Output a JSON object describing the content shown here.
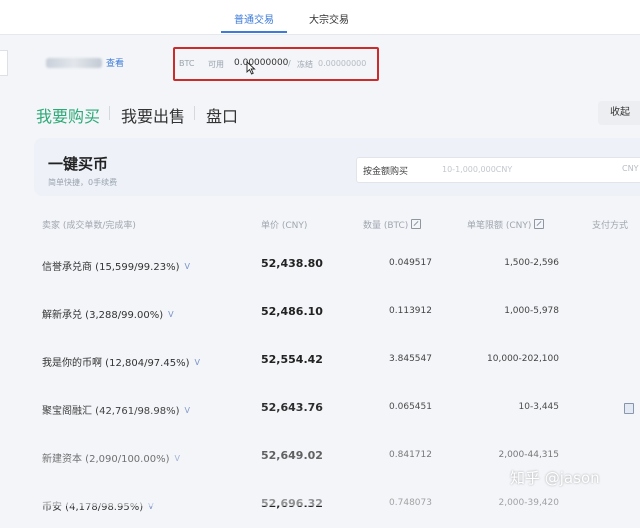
{
  "top_tabs": {
    "normal": "普通交易",
    "block": "大宗交易"
  },
  "account": {
    "view_link": "查看",
    "balance_currency": "BTC",
    "available_label": "可用",
    "available_value": "0.00000000",
    "separator": "/",
    "frozen_label": "冻结",
    "frozen_value": "0.00000000"
  },
  "mode_tabs": {
    "buy": "我要购买",
    "sell": "我要出售",
    "book": "盘口"
  },
  "collapse_label": "收起",
  "quick_buy": {
    "title": "一键买币",
    "subtitle": "简单快捷，0手续费",
    "amount_label": "按金额购买",
    "amount_placeholder": "10-1,000,000CNY",
    "unit": "CNY"
  },
  "table": {
    "headers": {
      "seller": "卖家 (成交单数/完成率)",
      "price": "单价 (CNY)",
      "qty": "数量 (BTC)",
      "limit": "单笔限额 (CNY)",
      "pay": "支付方式"
    },
    "rows": [
      {
        "seller": "信誉承兑商 (15,599/99.23%)",
        "badge": "V",
        "price": "52,438.80",
        "qty": "0.049517",
        "limit": "1,500-2,596",
        "pay_icon": false
      },
      {
        "seller": "解新承兑 (3,288/99.00%)",
        "badge": "V",
        "price": "52,486.10",
        "qty": "0.113912",
        "limit": "1,000-5,978",
        "pay_icon": false
      },
      {
        "seller": "我是你的币啊 (12,804/97.45%)",
        "badge": "V",
        "price": "52,554.42",
        "qty": "3.845547",
        "limit": "10,000-202,100",
        "pay_icon": false
      },
      {
        "seller": "聚宝阁融汇 (42,761/98.98%)",
        "badge": "V",
        "price": "52,643.76",
        "qty": "0.065451",
        "limit": "10-3,445",
        "pay_icon": true
      },
      {
        "seller": "新建资本 (2,090/100.00%)",
        "badge": "V",
        "price": "52,649.02",
        "qty": "0.841712",
        "limit": "2,000-44,315",
        "pay_icon": false
      },
      {
        "seller": "币安 (4,178/98.95%)",
        "badge": "V",
        "price": "52,696.32",
        "qty": "0.748073",
        "limit": "2,000-39,420",
        "pay_icon": false
      }
    ]
  },
  "watermark": "知乎 @jason",
  "icons": {
    "cursor": "mouse-pointer-icon",
    "edit": "edit-icon",
    "verified": "verified-badge-icon",
    "payment": "payment-method-icon"
  },
  "colors": {
    "accent_blue": "#3d7bd8",
    "buy_green": "#2eaa77",
    "highlight_red": "#cc2b2b"
  }
}
